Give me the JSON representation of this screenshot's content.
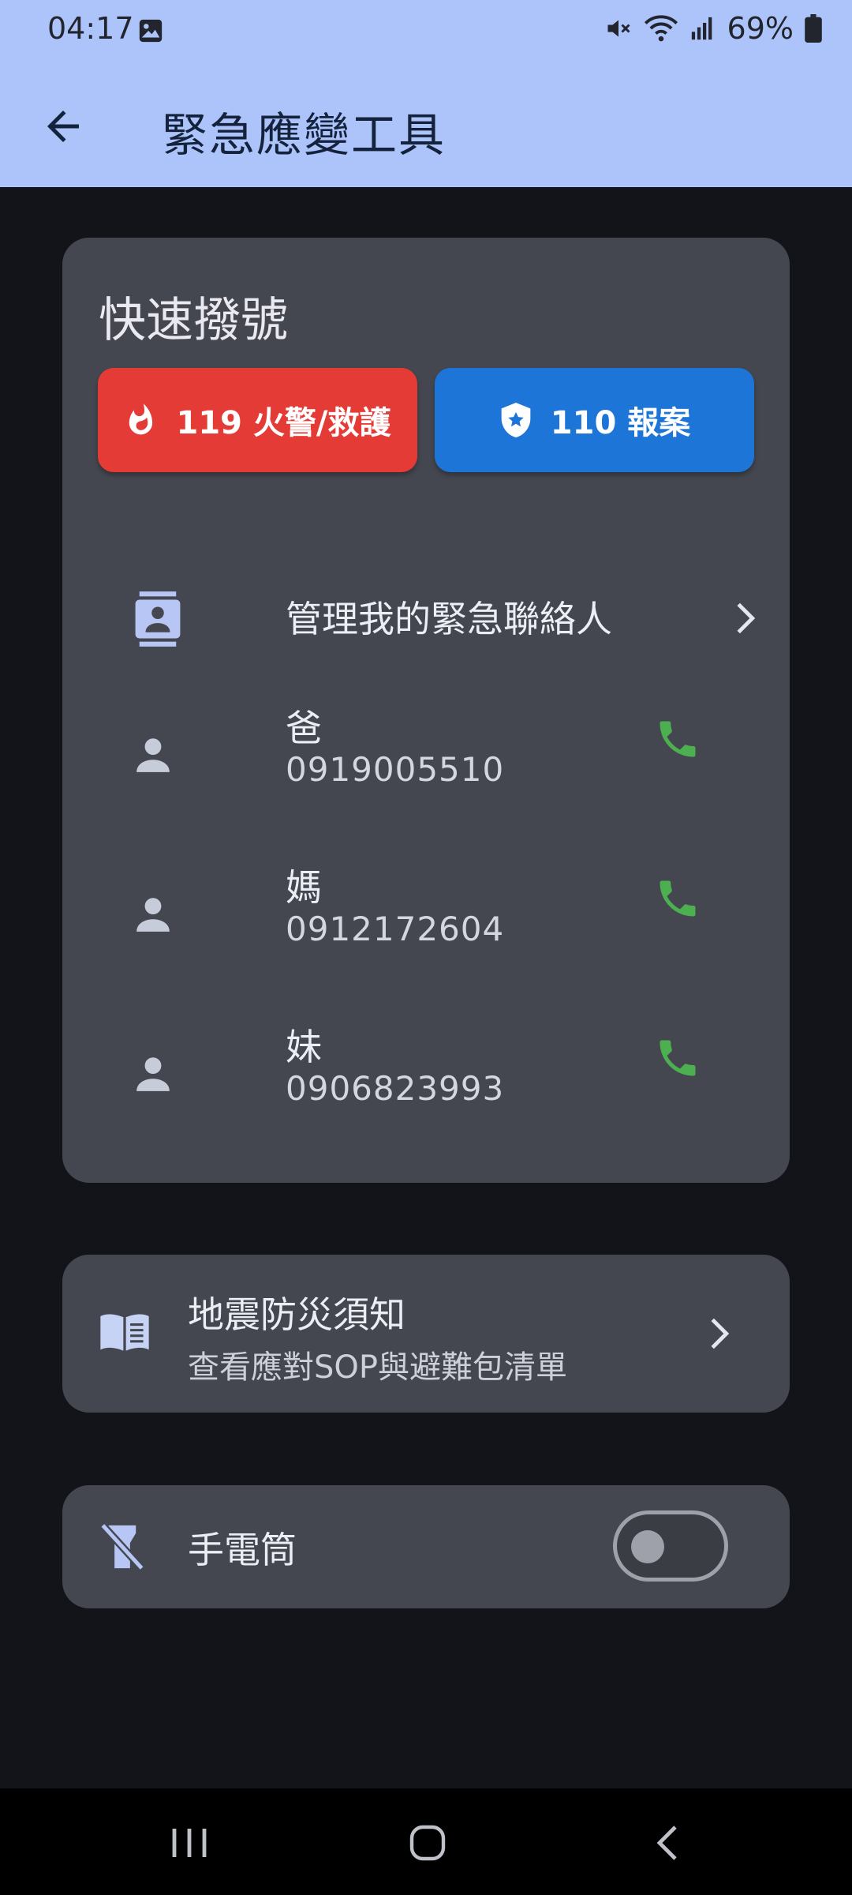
{
  "status_bar": {
    "time": "04:17",
    "battery": "69%"
  },
  "app_bar": {
    "title": "緊急應變工具"
  },
  "quick_dial": {
    "title": "快速撥號",
    "fire_button": "119 火警/救護",
    "police_button": "110 報案",
    "manage_contacts": "管理我的緊急聯絡人",
    "contacts": [
      {
        "name": "爸",
        "phone": "0919005510"
      },
      {
        "name": "媽",
        "phone": "0912172604"
      },
      {
        "name": "妹",
        "phone": "0906823993"
      }
    ]
  },
  "earthquake": {
    "title": "地震防災須知",
    "subtitle": "查看應對SOP與避難包清單"
  },
  "flashlight": {
    "label": "手電筒",
    "enabled": false
  },
  "colors": {
    "app_bar": "#adc4fb",
    "background": "#131419",
    "card": "#454750",
    "fire": "#e53b36",
    "police": "#1d75d8",
    "call_icon": "#4caf50",
    "icon_accent": "#b7c6f5"
  },
  "icons": {
    "back": "arrow-back-icon",
    "fire": "flame-icon",
    "police": "shield-star-icon",
    "contacts": "contacts-icon",
    "person": "person-icon",
    "call": "phone-icon",
    "book": "book-icon",
    "flashlight": "flashlight-off-icon"
  }
}
